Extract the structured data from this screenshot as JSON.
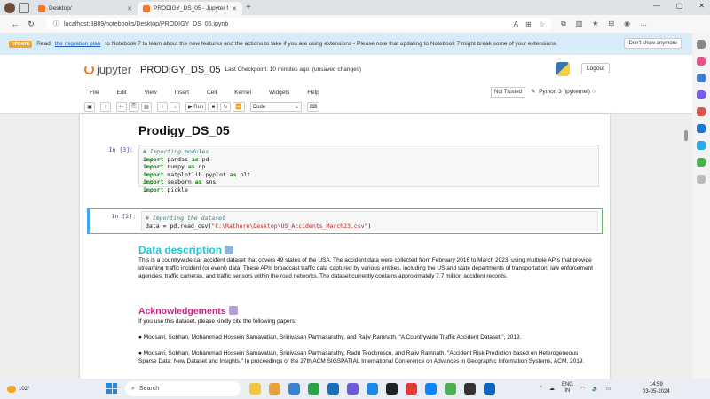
{
  "browser": {
    "tabs": [
      {
        "title": "Desktop/",
        "favicon_color": "#f37726",
        "active": false
      },
      {
        "title": "PRODIGY_DS_05 - Jupyter Notebook",
        "favicon_color": "#f37726",
        "active": true
      }
    ],
    "url": "localhost:8889/notebooks/Desktop/PRODIGY_DS_05.ipynb"
  },
  "banner": {
    "badge": "UPDATE",
    "text_before": "Read",
    "link": "the migration plan",
    "text_after": "to Notebook 7 to learn about the new features and the actions to take if you are using extensions - Please note that updating to Notebook 7 might break some of your extensions.",
    "dismiss": "Don't show anymore"
  },
  "header": {
    "logo_text": "jupyter",
    "notebook_name": "PRODIGY_DS_05",
    "checkpoint": "Last Checkpoint: 10 minutes ago",
    "unsaved": "(unsaved changes)",
    "logout": "Logout"
  },
  "menu": [
    "File",
    "Edit",
    "View",
    "Insert",
    "Cell",
    "Kernel",
    "Widgets",
    "Help"
  ],
  "status": {
    "trusted": "Not Trusted",
    "kernel": "Python 3 (ipykernel)"
  },
  "toolbar": {
    "run_label": "Run",
    "cell_type": "Code"
  },
  "notebook": {
    "title": "Prodigy_DS_05",
    "cell1": {
      "prompt": "In [3]:",
      "comment": "# Importing modules",
      "lines": [
        {
          "kw": "import",
          "rest": " pandas ",
          "kw2": "as",
          "alias": " pd"
        },
        {
          "kw": "import",
          "rest": " numpy ",
          "kw2": "as",
          "alias": " np"
        },
        {
          "kw": "import",
          "rest": " matplotlib.pyplot ",
          "kw2": "as",
          "alias": " plt"
        },
        {
          "kw": "import",
          "rest": " seaborn ",
          "kw2": "as",
          "alias": " sns"
        },
        {
          "kw": "import",
          "rest": " pickle",
          "kw2": "",
          "alias": ""
        }
      ]
    },
    "cell2": {
      "prompt": "In [2]:",
      "comment": "# Importing the dataset",
      "code_prefix": "data = pd.read_csv(",
      "code_string": "\"C:\\Rathore\\Desktop\\US_Accidents_March23.csv\"",
      "code_suffix": ")"
    },
    "md1": {
      "heading": "Data description",
      "text": "This is a countrywide car accident dataset that covers 49 states of the USA. The accident data were collected from February 2016 to March 2023, using multiple APIs that provide streaming traffic incident (or event) data. These APIs broadcast traffic data captured by various entities, including the US and state departments of transportation, law enforcement agencies, traffic cameras, and traffic sensors within the road networks. The dataset currently contains approximately 7.7 million accident records."
    },
    "md2": {
      "heading": "Acknowledgements",
      "intro": "If you use this dataset, please kindly cite the following papers:",
      "cite1": "Moosavi, Sobhan, Mohammad Hossein Samavatian, Srinivasan Parthasarathy, and Rajiv Ramnath. “A Countrywide Traffic Accident Dataset.”, 2019.",
      "cite2": "Moosavi, Sobhan, Mohammad Hossein Samavatian, Srinivasan Parthasarathy, Radu Teodorescu, and Rajiv Ramnath. \"Accident Risk Prediction based on Heterogeneous Sparse Data: New Dataset and Insights.\" In proceedings of the 27th ACM SIGSPATIAL International Conference on Advances in Geographic Information Systems, ACM, 2019."
    }
  },
  "taskbar": {
    "temperature": "102°",
    "search_placeholder": "Search",
    "lang": "ENG",
    "region": "IN",
    "time": "14:59",
    "date": "03-05-2024",
    "app_colors": [
      "#f4c542",
      "#e9a13b",
      "#3a82d6",
      "#2aa14b",
      "#1b6fb8",
      "#6b5bd6",
      "#1e88e5",
      "#222222",
      "#e53935",
      "#0a84ff",
      "#4caf50",
      "#333333",
      "#0a66c2"
    ]
  }
}
